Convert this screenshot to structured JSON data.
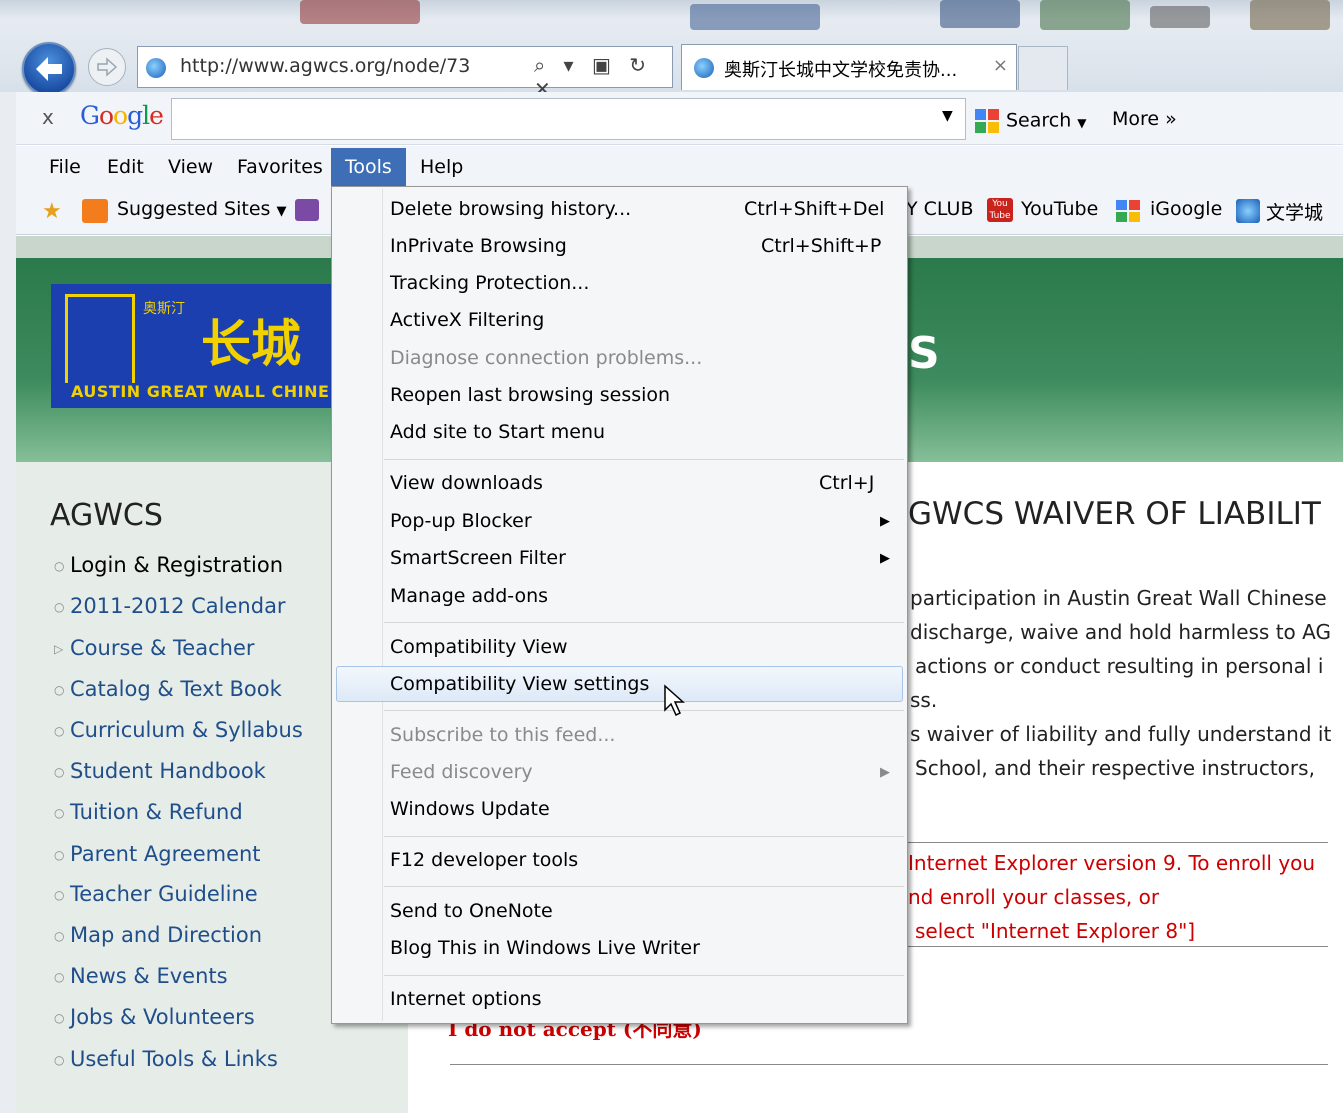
{
  "browser": {
    "url": "http://www.agwcs.org/node/73",
    "tab_title": "奥斯汀长城中文学校免责协...",
    "tab_close": "×",
    "address_controls": "⌕ ▾ ▣ ↻ ✕"
  },
  "google_toolbar": {
    "close": "x",
    "logo": "Google",
    "search_value": "",
    "search_label": "Search",
    "more_label": "More »"
  },
  "menu": {
    "file": "File",
    "edit": "Edit",
    "view": "View",
    "favorites": "Favorites",
    "tools": "Tools",
    "help": "Help"
  },
  "favorites": {
    "suggested": "Suggested Sites",
    "club": "Y CLUB",
    "youtube": "YouTube",
    "igoogle": "iGoogle",
    "wenxue": "文学城"
  },
  "tools_menu": {
    "items": [
      {
        "label": "Delete browsing history...",
        "shortcut": "Ctrl+Shift+Del"
      },
      {
        "label": "InPrivate Browsing",
        "shortcut": "Ctrl+Shift+P"
      },
      {
        "label": "Tracking Protection...",
        "shortcut": ""
      },
      {
        "label": "ActiveX Filtering",
        "shortcut": ""
      },
      {
        "label": "Diagnose connection problems...",
        "shortcut": ""
      },
      {
        "label": "Reopen last browsing session",
        "shortcut": ""
      },
      {
        "label": "Add site to Start menu",
        "shortcut": ""
      },
      {
        "label": "View downloads",
        "shortcut": "Ctrl+J"
      },
      {
        "label": "Pop-up Blocker",
        "shortcut": ""
      },
      {
        "label": "SmartScreen Filter",
        "shortcut": ""
      },
      {
        "label": "Manage add-ons",
        "shortcut": ""
      },
      {
        "label": "Compatibility View",
        "shortcut": ""
      },
      {
        "label": "Compatibility View settings",
        "shortcut": ""
      },
      {
        "label": "Subscribe to this feed...",
        "shortcut": ""
      },
      {
        "label": "Feed discovery",
        "shortcut": ""
      },
      {
        "label": "Windows Update",
        "shortcut": ""
      },
      {
        "label": "F12 developer tools",
        "shortcut": ""
      },
      {
        "label": "Send to OneNote",
        "shortcut": ""
      },
      {
        "label": "Blog This in Windows Live Writer",
        "shortcut": ""
      },
      {
        "label": "Internet options",
        "shortcut": ""
      }
    ]
  },
  "site": {
    "logo_cn": "长城",
    "logo_small": "奥斯汀",
    "logo_en": "AUSTIN GREAT WALL CHINE",
    "banner_partial": "S",
    "sidebar_title": "AGWCS",
    "sidebar_items": [
      "Login & Registration",
      "2011-2012 Calendar",
      "Course & Teacher",
      "Catalog & Text Book",
      "Curriculum & Syllabus",
      "Student Handbook",
      "Tuition & Refund",
      "Parent Agreement",
      "Teacher Guideline",
      "Map and Direction",
      "News & Events",
      "Jobs & Volunteers",
      "Useful Tools & Links"
    ],
    "content_title": "GWCS WAIVER OF LIABILIT",
    "body_lines": [
      "participation in Austin Great Wall Chinese",
      "discharge, waive and hold harmless to AG",
      "actions or conduct resulting in personal i",
      "ss.",
      "s waiver of liability and fully understand it",
      "School, and their respective instructors,"
    ],
    "notice_lines": [
      "Internet Explorer version 9. To enroll you",
      "nd enroll your classes, or",
      "select \"Internet Explorer 8\"]"
    ],
    "decline": "I do not accept (不同意)"
  }
}
